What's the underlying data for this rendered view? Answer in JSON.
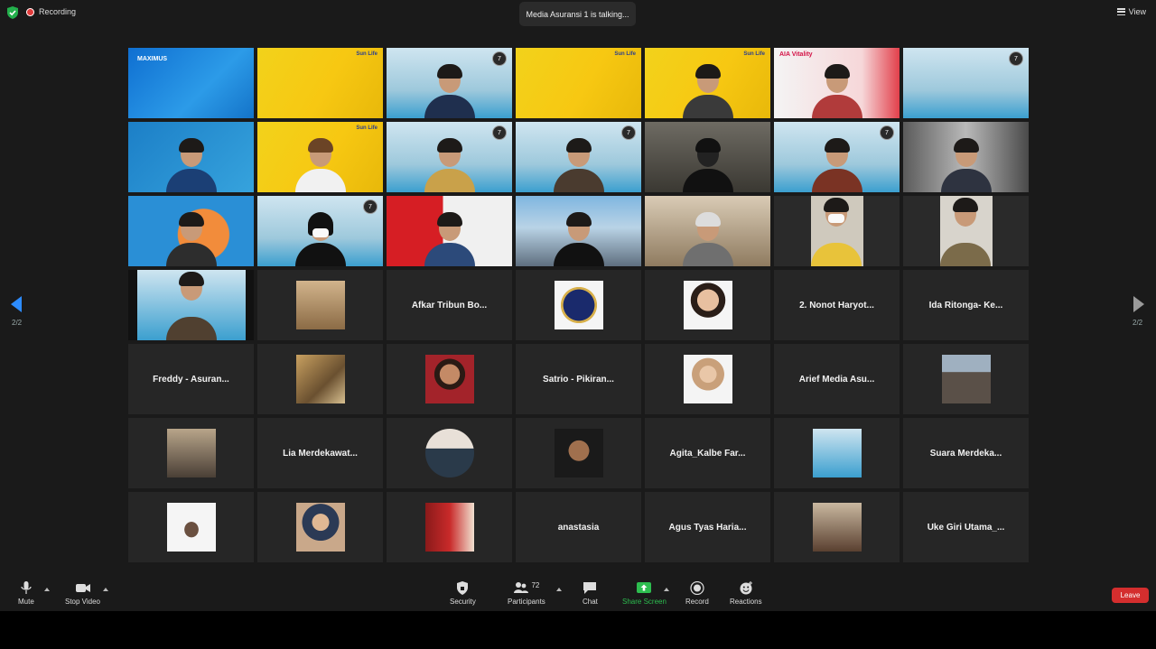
{
  "app": {
    "recording_label": "Recording",
    "talking_indicator": "Media Asuransi 1 is talking...",
    "view_label": "View"
  },
  "pagination": {
    "left": "2/2",
    "right": "2/2"
  },
  "tile_labels": {
    "maximus": "MAXIMUS",
    "sunlife": "Sun Life",
    "aia": "AIA Vitality",
    "badge": "7"
  },
  "name_tiles": [
    "Afkar Tribun Bo...",
    "2. Nonot Haryot...",
    "Ida Ritonga- Ke...",
    "Freddy - Asuran...",
    "Satrio - Pikiran...",
    "Arief Media Asu...",
    "Lia Merdekawat...",
    "Agita_Kalbe Far...",
    "Suara Merdeka...",
    "anastasia",
    "Agus Tyas Haria...",
    "Uke Giri Utama_..."
  ],
  "participants_count": "72",
  "toolbar": {
    "mute": "Mute",
    "stop_video": "Stop Video",
    "security": "Security",
    "participants": "Participants",
    "chat": "Chat",
    "share_screen": "Share Screen",
    "record": "Record",
    "reactions": "Reactions",
    "leave": "Leave"
  },
  "colors": {
    "share_green": "#2dbd4f",
    "leave_red": "#d42e2e",
    "record_red": "#e23b3b"
  }
}
